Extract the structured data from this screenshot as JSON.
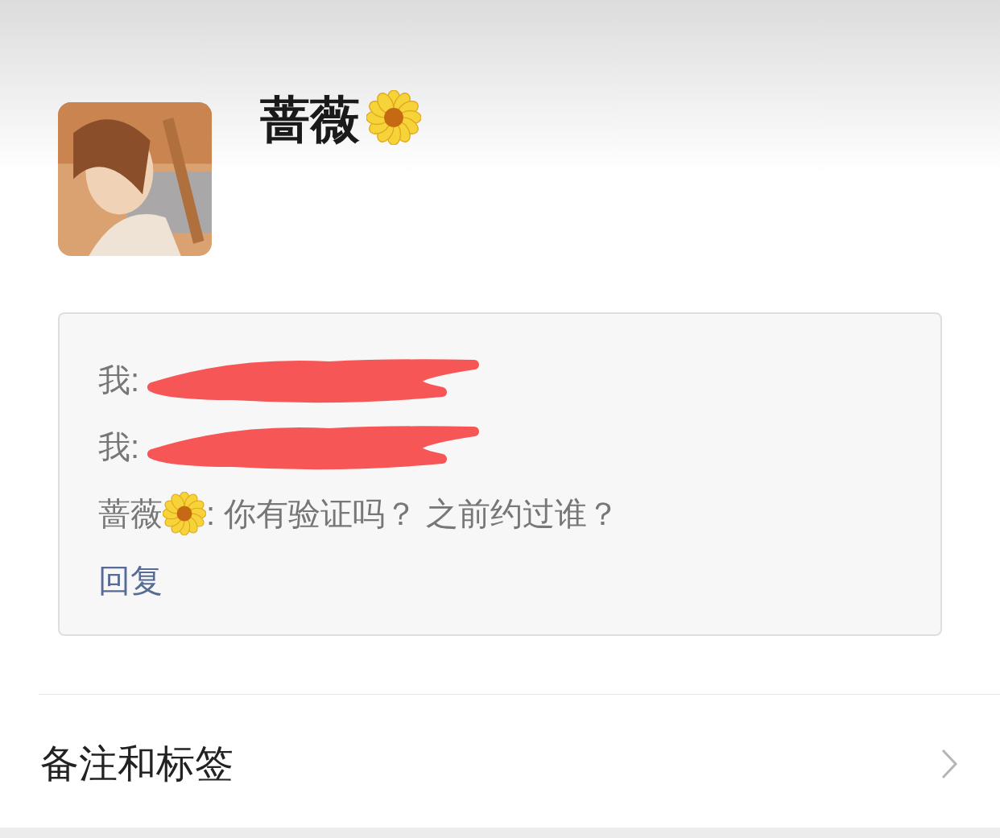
{
  "contact": {
    "name": "蔷薇"
  },
  "request": {
    "messages": [
      {
        "kind": "self",
        "sender": "我:"
      },
      {
        "kind": "self",
        "sender": "我:"
      },
      {
        "kind": "contact",
        "sender": "蔷薇",
        "text": ": 你有验证吗？ 之前约过谁？"
      }
    ],
    "reply": "回复"
  },
  "section": {
    "label": "备注和标签"
  }
}
